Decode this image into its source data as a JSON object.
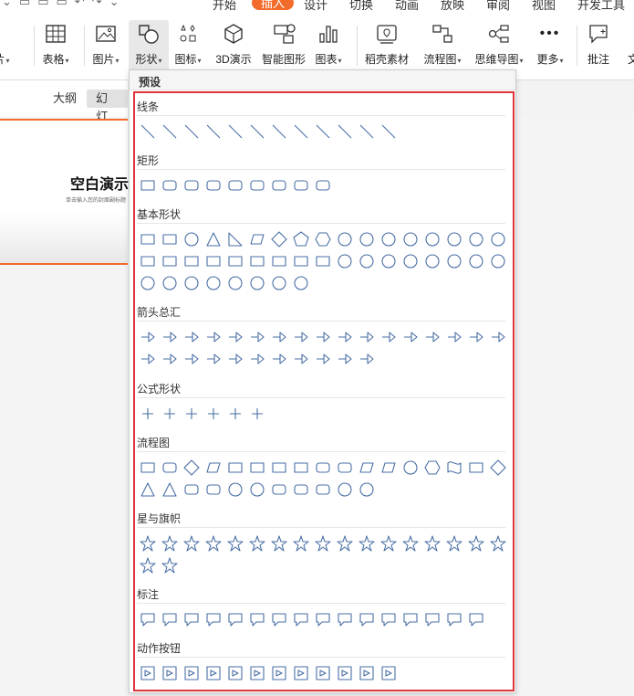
{
  "menu": {
    "items": [
      {
        "label": "开始",
        "active": false
      },
      {
        "label": "插入",
        "active": true
      },
      {
        "label": "设计",
        "active": false
      },
      {
        "label": "切换",
        "active": false
      },
      {
        "label": "动画",
        "active": false
      },
      {
        "label": "放映",
        "active": false
      },
      {
        "label": "审阅",
        "active": false
      },
      {
        "label": "视图",
        "active": false
      },
      {
        "label": "开发工具",
        "active": false
      }
    ]
  },
  "ribbon": {
    "buttons": [
      {
        "label": "片",
        "icon": "picture-icon",
        "dropdown": true
      },
      {
        "label": "表格",
        "icon": "table-icon",
        "dropdown": true
      },
      {
        "label": "图片",
        "icon": "image-icon",
        "dropdown": true
      },
      {
        "label": "形状",
        "icon": "shapes-icon",
        "dropdown": true,
        "selected": true
      },
      {
        "label": "图标",
        "icon": "icons-icon",
        "dropdown": true
      },
      {
        "label": "3D演示",
        "icon": "cube-icon",
        "dropdown": false
      },
      {
        "label": "智能图形",
        "icon": "smartart-icon",
        "dropdown": false
      },
      {
        "label": "图表",
        "icon": "chart-icon",
        "dropdown": true
      },
      {
        "label": "稻壳素材",
        "icon": "docer-icon",
        "dropdown": false
      },
      {
        "label": "流程图",
        "icon": "flowchart-icon",
        "dropdown": true
      },
      {
        "label": "思维导图",
        "icon": "mindmap-icon",
        "dropdown": true
      },
      {
        "label": "更多",
        "icon": "more-icon",
        "dropdown": true
      },
      {
        "label": "批注",
        "icon": "comment-icon",
        "dropdown": false
      },
      {
        "label": "文",
        "icon": "text-icon",
        "dropdown": false
      }
    ]
  },
  "viewtabs": {
    "outline": "大纲",
    "slides": "幻灯片"
  },
  "slide": {
    "title": "空白演示",
    "subtitle": "单击输入您的封面副标题"
  },
  "panel": {
    "header": "预设",
    "accent_color": "#e0353a",
    "shape_color": "#4a6fa5",
    "sections": [
      {
        "title": "线条",
        "count": 12
      },
      {
        "title": "矩形",
        "count": 9
      },
      {
        "title": "基本形状",
        "count": 42
      },
      {
        "title": "箭头总汇",
        "count": 28
      },
      {
        "title": "公式形状",
        "count": 6
      },
      {
        "title": "流程图",
        "count": 28
      },
      {
        "title": "星与旗帜",
        "count": 19
      },
      {
        "title": "标注",
        "count": 16
      },
      {
        "title": "动作按钮",
        "count": 12
      }
    ]
  }
}
